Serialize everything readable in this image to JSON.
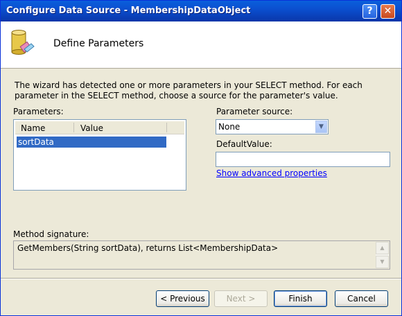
{
  "window": {
    "title": "Configure Data Source - MembershipDataObject",
    "help_label": "?",
    "close_label": "✕"
  },
  "header": {
    "title": "Define Parameters",
    "icon": "database-icon"
  },
  "description": "The wizard has detected one or more parameters in your SELECT method. For each parameter in the SELECT method, choose a source for the parameter's value.",
  "parameters": {
    "label": "Parameters:",
    "columns": [
      "Name",
      "Value"
    ],
    "rows": [
      {
        "name": "sortData",
        "value": ""
      }
    ]
  },
  "parameter_source": {
    "label": "Parameter source:",
    "value": "None"
  },
  "default_value": {
    "label": "DefaultValue:",
    "value": ""
  },
  "advanced_link": "Show advanced properties",
  "method_signature": {
    "label": "Method signature:",
    "value": "GetMembers(String sortData), returns List<MembershipData>"
  },
  "buttons": {
    "previous": "< Previous",
    "next": "Next >",
    "finish": "Finish",
    "cancel": "Cancel"
  }
}
